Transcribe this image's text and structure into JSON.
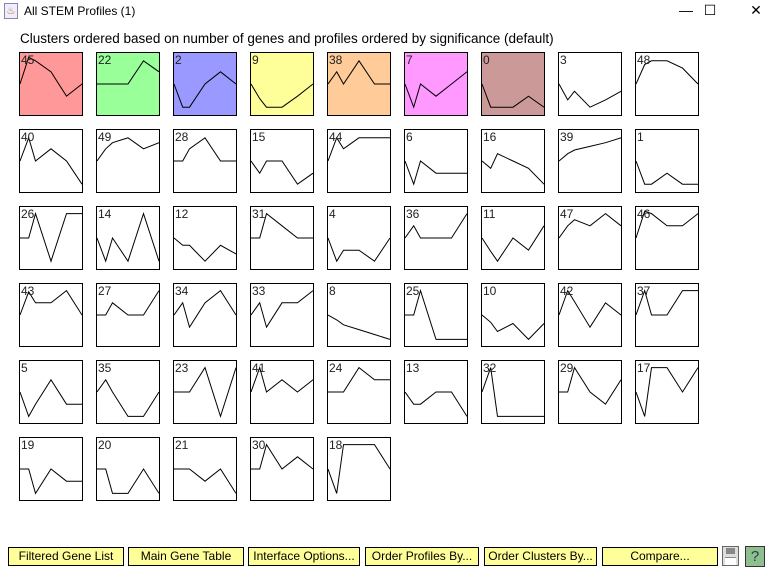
{
  "window": {
    "title": "All STEM Profiles (1)",
    "minimize": "—",
    "maximize": "☐",
    "close": "✕"
  },
  "subtitle": "Clusters ordered based on number of genes and profiles ordered by significance (default)",
  "time_points": [
    0,
    0.14,
    0.25,
    0.5,
    0.75,
    1
  ],
  "profiles": [
    {
      "id": "45",
      "color": "#ff9999",
      "values": [
        0,
        2.2,
        1.9,
        1,
        -1,
        0
      ]
    },
    {
      "id": "22",
      "color": "#99ff99",
      "values": [
        0,
        0,
        0,
        0,
        1.9,
        1
      ]
    },
    {
      "id": "2",
      "color": "#9999ff",
      "values": [
        0,
        -1.9,
        -1.9,
        0,
        1,
        0
      ]
    },
    {
      "id": "9",
      "color": "#ffff99",
      "values": [
        0,
        -1.2,
        -1.9,
        -1.9,
        -1,
        0
      ]
    },
    {
      "id": "38",
      "color": "#ffcc99",
      "values": [
        0,
        1,
        0,
        1.9,
        0,
        0
      ]
    },
    {
      "id": "7",
      "color": "#ff99ff",
      "values": [
        0,
        -1.9,
        0,
        -1,
        0,
        1
      ]
    },
    {
      "id": "0",
      "color": "#cc9999",
      "values": [
        0,
        -1.9,
        -1.9,
        -1.9,
        -1,
        -1.9
      ]
    },
    {
      "id": "3",
      "color": "#ffffff",
      "values": [
        0,
        -1.3,
        -0.6,
        -1.9,
        -1.3,
        -0.6
      ]
    },
    {
      "id": "48",
      "color": "#ffffff",
      "values": [
        0,
        1.6,
        1.9,
        1.9,
        1.3,
        0
      ]
    },
    {
      "id": "40",
      "color": "#ffffff",
      "values": [
        0,
        1.9,
        0,
        1,
        0,
        -1.9
      ]
    },
    {
      "id": "49",
      "color": "#ffffff",
      "values": [
        0,
        1,
        1.5,
        1.9,
        1,
        1.5
      ]
    },
    {
      "id": "28",
      "color": "#ffffff",
      "values": [
        0,
        0,
        1,
        1.9,
        0,
        0
      ]
    },
    {
      "id": "15",
      "color": "#ffffff",
      "values": [
        0,
        -1,
        0,
        0,
        -1.9,
        -1
      ]
    },
    {
      "id": "44",
      "color": "#ffffff",
      "values": [
        0,
        1.9,
        1,
        1.9,
        1.9,
        1.9
      ]
    },
    {
      "id": "6",
      "color": "#ffffff",
      "values": [
        0,
        -1.9,
        0,
        -1,
        -1,
        -1
      ]
    },
    {
      "id": "16",
      "color": "#ffffff",
      "values": [
        0,
        -0.6,
        0.6,
        0,
        -0.6,
        -1.9
      ]
    },
    {
      "id": "39",
      "color": "#ffffff",
      "values": [
        0,
        0.6,
        0.9,
        1.2,
        1.5,
        1.9
      ]
    },
    {
      "id": "1",
      "color": "#ffffff",
      "values": [
        0,
        -1.9,
        -1.9,
        -1,
        -1.9,
        -1.9
      ]
    },
    {
      "id": "26",
      "color": "#ffffff",
      "values": [
        0,
        0,
        2,
        -1.9,
        2,
        2
      ]
    },
    {
      "id": "14",
      "color": "#ffffff",
      "values": [
        0,
        -1.9,
        0,
        -1.9,
        2,
        -1.9
      ]
    },
    {
      "id": "12",
      "color": "#ffffff",
      "values": [
        0,
        -0.6,
        -0.6,
        -1.9,
        -0.6,
        -1.3
      ]
    },
    {
      "id": "31",
      "color": "#ffffff",
      "values": [
        0,
        0,
        2,
        1,
        0,
        0
      ]
    },
    {
      "id": "4",
      "color": "#ffffff",
      "values": [
        0,
        -1.9,
        -1,
        -1,
        -1.9,
        0
      ]
    },
    {
      "id": "36",
      "color": "#ffffff",
      "values": [
        0,
        1,
        0,
        0,
        0,
        2
      ]
    },
    {
      "id": "11",
      "color": "#ffffff",
      "values": [
        0,
        -1.1,
        -1.9,
        0,
        -1,
        1
      ]
    },
    {
      "id": "47",
      "color": "#ffffff",
      "values": [
        0,
        1,
        1.5,
        1,
        2,
        1
      ]
    },
    {
      "id": "46",
      "color": "#ffffff",
      "values": [
        0,
        2.2,
        2,
        1,
        1,
        2
      ]
    },
    {
      "id": "43",
      "color": "#ffffff",
      "values": [
        0,
        1.9,
        1,
        1,
        2,
        0
      ]
    },
    {
      "id": "27",
      "color": "#ffffff",
      "values": [
        0,
        0,
        1,
        0,
        0,
        2
      ]
    },
    {
      "id": "34",
      "color": "#ffffff",
      "values": [
        0,
        1,
        -1,
        1,
        2,
        0
      ]
    },
    {
      "id": "33",
      "color": "#ffffff",
      "values": [
        0,
        1,
        -1,
        1,
        1,
        2
      ]
    },
    {
      "id": "8",
      "color": "#ffffff",
      "values": [
        0,
        -0.4,
        -0.8,
        -1.2,
        -1.6,
        -2
      ]
    },
    {
      "id": "25",
      "color": "#ffffff",
      "values": [
        0,
        0,
        2,
        -2,
        -2,
        -2
      ]
    },
    {
      "id": "10",
      "color": "#ffffff",
      "values": [
        0,
        -0.6,
        -1.35,
        -0.7,
        -2,
        -0.7
      ]
    },
    {
      "id": "42",
      "color": "#ffffff",
      "values": [
        0,
        2,
        1.1,
        -1,
        1,
        0
      ]
    },
    {
      "id": "37",
      "color": "#ffffff",
      "values": [
        0,
        2,
        0,
        0,
        2,
        2
      ]
    },
    {
      "id": "5",
      "color": "#ffffff",
      "values": [
        0,
        -2,
        -1,
        1,
        -1,
        -1
      ]
    },
    {
      "id": "35",
      "color": "#ffffff",
      "values": [
        0,
        1,
        0,
        -2,
        -2,
        0
      ]
    },
    {
      "id": "23",
      "color": "#ffffff",
      "values": [
        0,
        0,
        0,
        2,
        -2,
        2
      ]
    },
    {
      "id": "41",
      "color": "#ffffff",
      "values": [
        0,
        2,
        0,
        1,
        0,
        1
      ]
    },
    {
      "id": "24",
      "color": "#ffffff",
      "values": [
        0,
        0,
        0,
        2,
        1,
        1
      ]
    },
    {
      "id": "13",
      "color": "#ffffff",
      "values": [
        0,
        -1,
        -1,
        0,
        0,
        -2
      ]
    },
    {
      "id": "32",
      "color": "#ffffff",
      "values": [
        0,
        2,
        -2,
        -2,
        -2,
        -2
      ]
    },
    {
      "id": "29",
      "color": "#ffffff",
      "values": [
        0,
        0,
        2,
        0,
        -1,
        1
      ]
    },
    {
      "id": "17",
      "color": "#ffffff",
      "values": [
        0,
        -2,
        2,
        2,
        0,
        2
      ]
    },
    {
      "id": "19",
      "color": "#ffffff",
      "values": [
        0,
        0,
        -2,
        0,
        -1,
        -1
      ]
    },
    {
      "id": "20",
      "color": "#ffffff",
      "values": [
        0,
        0,
        -2,
        -2,
        0,
        -2
      ]
    },
    {
      "id": "21",
      "color": "#ffffff",
      "values": [
        0,
        0,
        0,
        -1,
        0,
        -2
      ]
    },
    {
      "id": "30",
      "color": "#ffffff",
      "values": [
        0,
        0,
        2,
        0,
        1,
        0
      ]
    },
    {
      "id": "18",
      "color": "#ffffff",
      "values": [
        0,
        -2,
        2,
        2,
        2,
        0
      ]
    }
  ],
  "buttons": {
    "filtered": "Filtered Gene List",
    "main_table": "Main Gene Table",
    "interface": "Interface Options...",
    "order_profiles": "Order Profiles By...",
    "order_clusters": "Order Clusters By...",
    "compare": "Compare...",
    "help": "?"
  },
  "icons": {
    "save": "floppy-disk-icon",
    "help": "help-icon",
    "app": "java-icon"
  }
}
